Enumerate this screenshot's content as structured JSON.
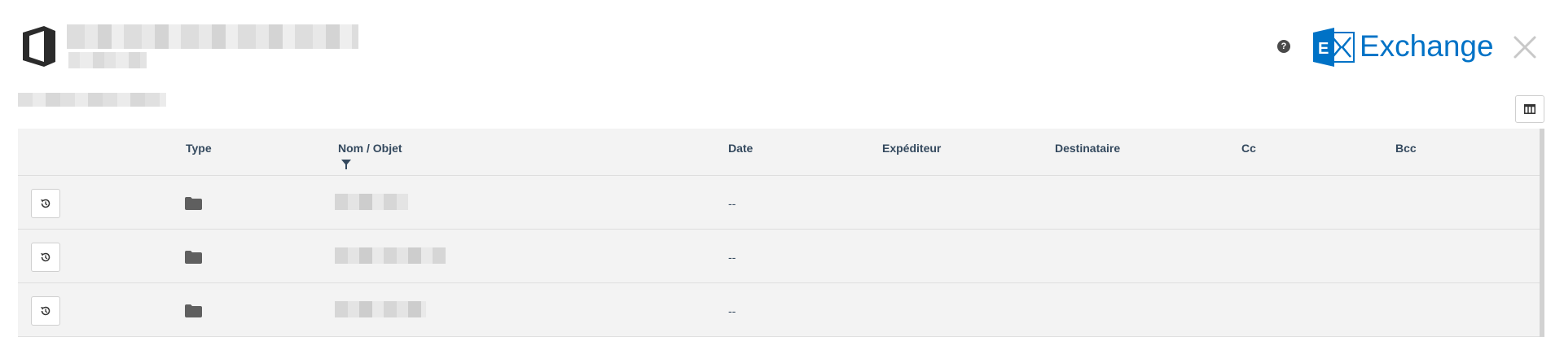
{
  "header": {
    "help_label": "?",
    "brand_label": "Exchange",
    "brand_color": "#0072c6"
  },
  "grid": {
    "columns": [
      {
        "key": "type",
        "label": "Type"
      },
      {
        "key": "name",
        "label": "Nom / Objet"
      },
      {
        "key": "date",
        "label": "Date"
      },
      {
        "key": "sender",
        "label": "Expéditeur"
      },
      {
        "key": "recipient",
        "label": "Destinataire"
      },
      {
        "key": "cc",
        "label": "Cc"
      },
      {
        "key": "bcc",
        "label": "Bcc"
      }
    ],
    "rows": [
      {
        "type_icon": "folder-icon",
        "date": "--"
      },
      {
        "type_icon": "folder-icon",
        "date": "--"
      },
      {
        "type_icon": "folder-icon",
        "date": "--"
      }
    ]
  },
  "icons": {
    "app": "office-logo-icon",
    "help": "question-circle-icon",
    "brand": "exchange-logo-icon",
    "close": "close-icon",
    "columns": "columns-icon",
    "filter": "filter-icon",
    "restore": "history-icon"
  }
}
